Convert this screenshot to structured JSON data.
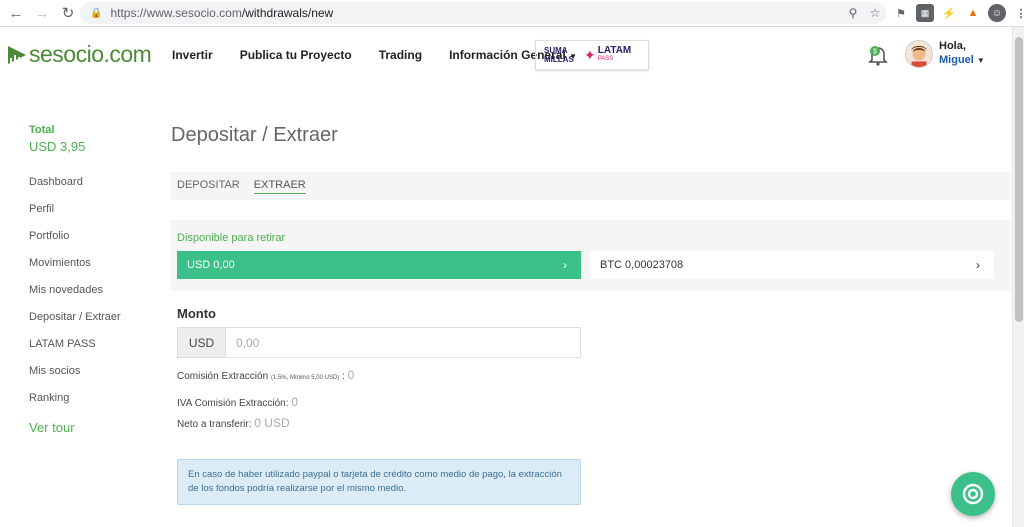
{
  "browser": {
    "url_host": "https://www.sesocio.com",
    "url_path": "/withdrawals/new"
  },
  "header": {
    "logo_text": "sesocio.com",
    "menu": [
      {
        "label": "Invertir"
      },
      {
        "label": "Publica tu Proyecto"
      },
      {
        "label": "Trading"
      },
      {
        "label": "Información General"
      }
    ],
    "partner": {
      "line1": "SUMA",
      "line2": "MILLAS",
      "brand": "LATAM",
      "sub": "PASS"
    },
    "user": {
      "greeting": "Hola,",
      "name": "Miguel"
    }
  },
  "sidebar": {
    "total_label": "Total",
    "total_value": "USD 3,95",
    "items": [
      {
        "label": "Dashboard"
      },
      {
        "label": "Perfil"
      },
      {
        "label": "Portfolio"
      },
      {
        "label": "Movimientos"
      },
      {
        "label": "Mis novedades"
      },
      {
        "label": "Depositar / Extraer"
      },
      {
        "label": "LATAM PASS"
      },
      {
        "label": "Mis socios"
      },
      {
        "label": "Ranking"
      }
    ],
    "tour_label": "Ver tour"
  },
  "main": {
    "title": "Depositar / Extraer",
    "tabs": [
      {
        "label": "DEPOSITAR",
        "active": false
      },
      {
        "label": "EXTRAER",
        "active": true
      }
    ],
    "available_label": "Disponible para retirar",
    "balances": {
      "usd": "USD 0,00",
      "btc": "BTC 0,00023708"
    },
    "amount_label": "Monto",
    "amount_currency": "USD",
    "amount_placeholder": "0,00",
    "fee_label": "Comisión Extracción",
    "fee_detail": "(1,5%, Mínimo 5,00 USD)",
    "fee_colon": ":",
    "fee_value": "0",
    "iva_label": "IVA Comisión Extracción:",
    "iva_value": "0",
    "net_label": "Neto a transferir:",
    "net_value": "0 USD",
    "notice": "En caso de haber utilizado paypal o tarjeta de crédito como medio de pago, la extracción de los fondos podría realizarse por el mismo medio."
  },
  "colors": {
    "brand_green": "#4b8a36",
    "accent_green": "#3cc08a",
    "link_green": "#4caf50",
    "notice_bg": "#dcecf6"
  }
}
